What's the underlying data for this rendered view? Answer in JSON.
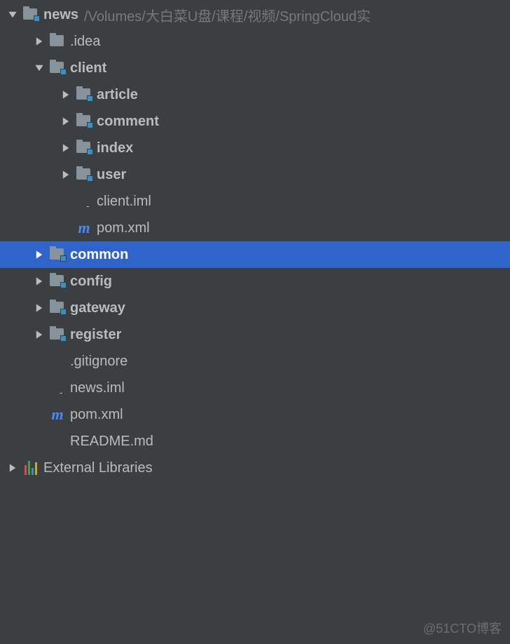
{
  "root": {
    "name": "news",
    "path": "/Volumes/大白菜U盘/课程/视频/SpringCloud实"
  },
  "items": {
    "idea": ".idea",
    "client": "client",
    "article": "article",
    "comment": "comment",
    "index": "index",
    "user": "user",
    "client_iml": "client.iml",
    "client_pom": "pom.xml",
    "common": "common",
    "config": "config",
    "gateway": "gateway",
    "register": "register",
    "gitignore": ".gitignore",
    "news_iml": "news.iml",
    "root_pom": "pom.xml",
    "readme": "README.md",
    "external_libs": "External Libraries"
  },
  "watermark": "@51CTO博客"
}
